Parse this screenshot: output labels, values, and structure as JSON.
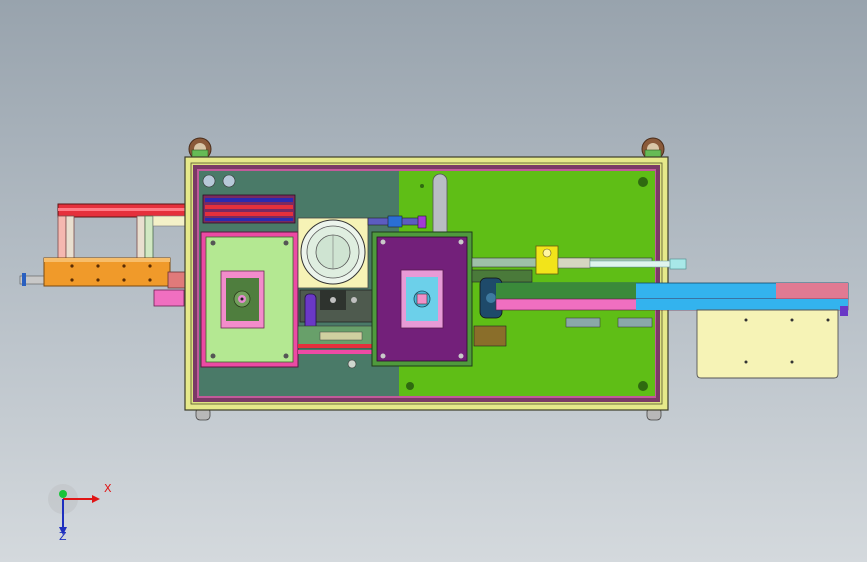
{
  "viewport": {
    "background_top": "#98a3ad",
    "background_bottom": "#d4d9dd"
  },
  "model": {
    "colors": {
      "frame_outer": "#e6e98a",
      "frame_inner": "#7a3a66",
      "plate_dark": "#4a7a68",
      "plate_green": "#5fbe16",
      "light_green": "#b4e892",
      "pink": "#ec4aa4",
      "purple": "#73207a",
      "orange": "#f09a2a",
      "red_rail": "#e5303c",
      "cyan": "#33b3ee",
      "cream": "#f6f3b6",
      "yellow": "#f2e41a"
    },
    "components": [
      "base-frame",
      "left-dark-plate",
      "right-green-plate",
      "left-fixture",
      "center-fixture",
      "vibratory-bowl",
      "left-feeder-arm",
      "orange-feeder-bar",
      "right-conveyor",
      "output-tray",
      "yellow-cylinder",
      "caster-wheels",
      "lifting-eyes"
    ]
  },
  "triad": {
    "x_label": "X",
    "z_label": "Z",
    "x_color": "#e01515",
    "y_color": "#19c43a",
    "z_color": "#1e2fbf"
  }
}
